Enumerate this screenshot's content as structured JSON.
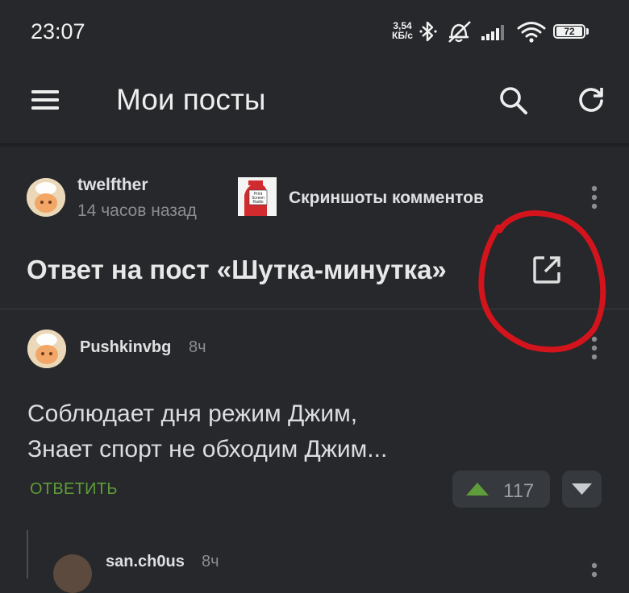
{
  "status_bar": {
    "time": "23:07",
    "net_speed_value": "3,54",
    "net_speed_unit": "КБ/с",
    "icons": [
      "bluetooth-icon",
      "alarm-off-icon",
      "signal-icon",
      "wifi-icon",
      "battery-icon"
    ],
    "battery": "72"
  },
  "app_bar": {
    "title": "Мои посты",
    "icons": [
      "menu-icon",
      "search-icon",
      "refresh-icon"
    ]
  },
  "post": {
    "author": "twelfther",
    "time": "14 часов назад",
    "community": "Скриншоты комментов",
    "community_logo_text": [
      "Print",
      "Screen",
      "Radio"
    ],
    "title": "Ответ на пост «Шутка-минутка»",
    "icons": [
      "more-vert-icon",
      "open-external-icon"
    ]
  },
  "comment": {
    "author": "Pushkinvbg",
    "time": "8ч",
    "lines": [
      "Соблюдает дня режим Джим,",
      "Знает спорт не обходим Джим..."
    ],
    "reply_label": "ОТВЕТИТЬ",
    "votes": "117"
  },
  "reply": {
    "author": "san.ch0us",
    "time": "8ч"
  },
  "colors": {
    "background": "#26282b",
    "accent_green": "#5f9c3a",
    "annotation_red": "#d4141c"
  }
}
